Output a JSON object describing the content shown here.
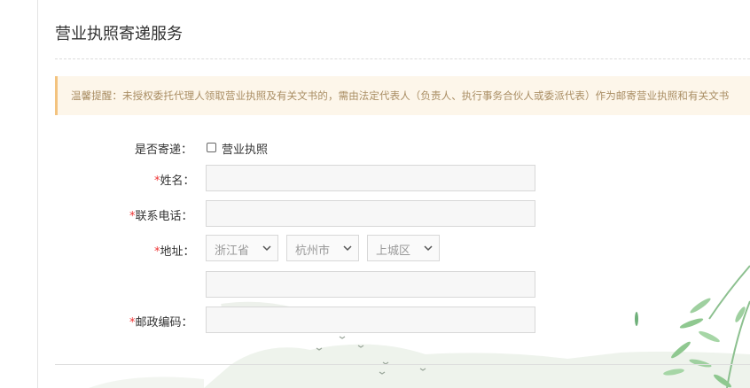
{
  "page": {
    "title": "营业执照寄递服务",
    "notice": "温馨提醒：未授权委托代理人领取营业执照及有关文书的，需由法定代表人（负责人、执行事务合伙人或委派代表）作为邮寄营业执照和有关文书"
  },
  "form": {
    "mail_label": "是否寄递：",
    "mail_option_label": "营业执照",
    "mail_option_checked": false,
    "required_mark": "*",
    "name_label": "姓名：",
    "name_value": "",
    "phone_label": "联系电话：",
    "phone_value": "",
    "address_label": "地址：",
    "province": "浙江省",
    "city": "杭州市",
    "district": "上城区",
    "address_detail_value": "",
    "postcode_label": "邮政编码：",
    "postcode_value": ""
  },
  "colors": {
    "required": "#e33333",
    "notice_bg": "#fdf6ea",
    "notice_border": "#f3c37f",
    "notice_text": "#a98d63"
  },
  "icons": [
    "chevron-down-icon",
    "bamboo-decoration",
    "bird-decoration"
  ]
}
